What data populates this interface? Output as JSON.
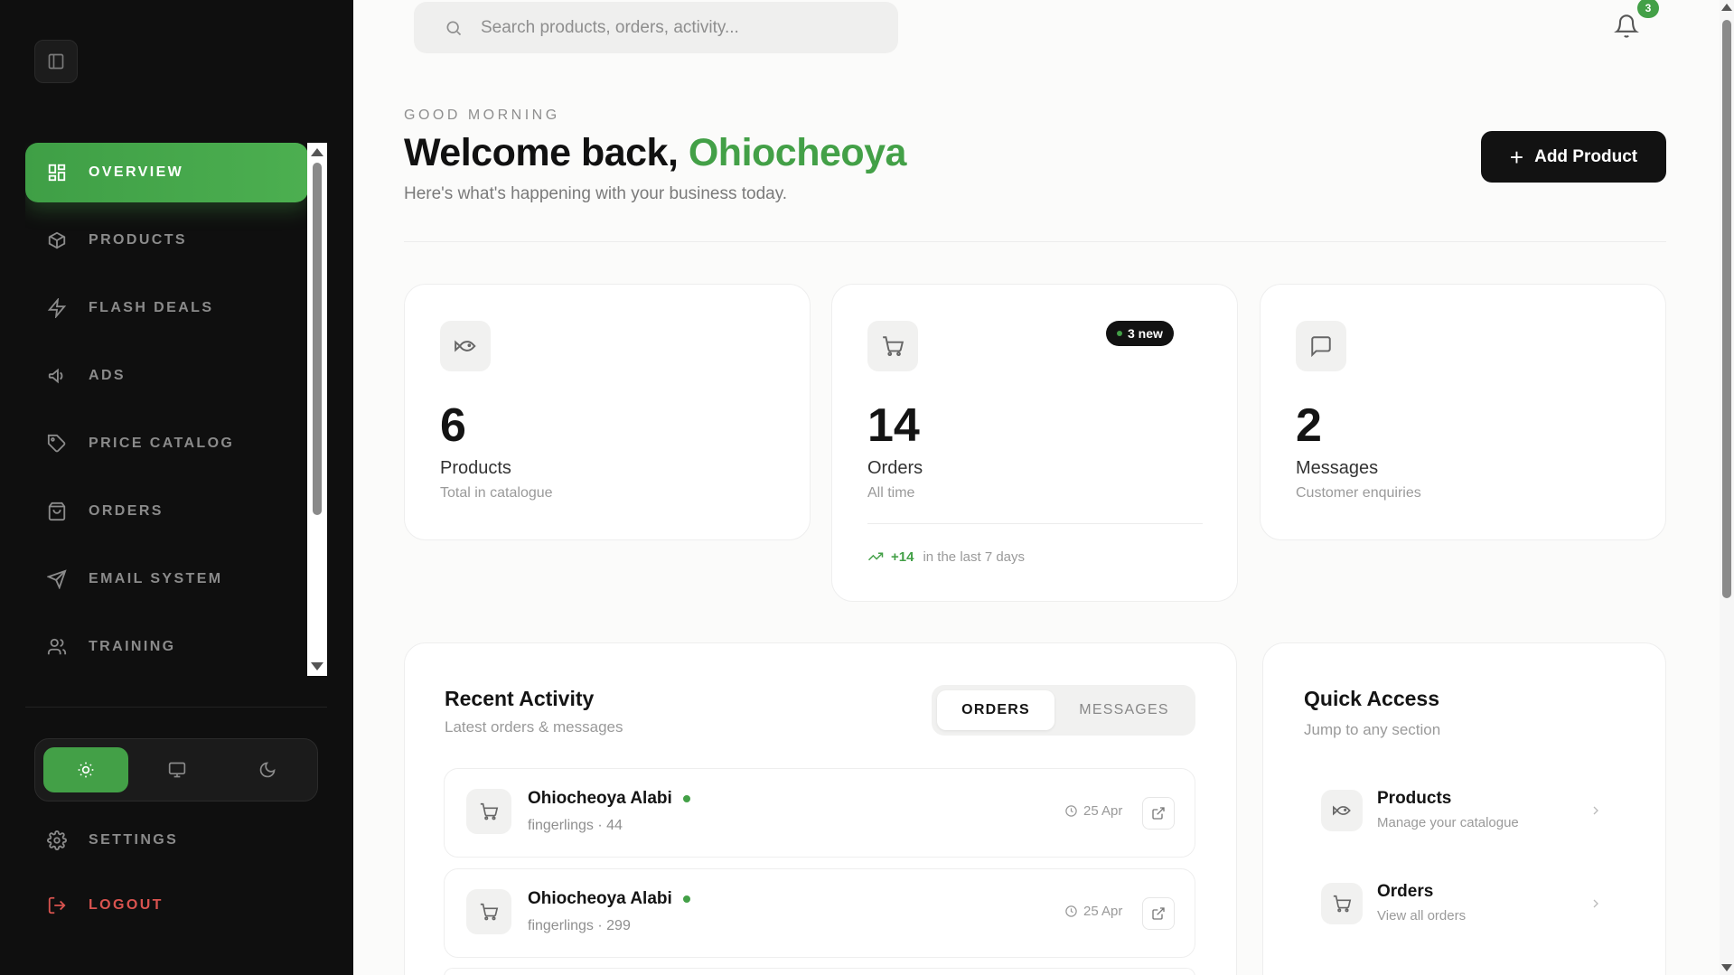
{
  "sidebar": {
    "nav_items": [
      {
        "label": "OVERVIEW",
        "icon": "grid-icon",
        "active": true
      },
      {
        "label": "PRODUCTS",
        "icon": "box-icon"
      },
      {
        "label": "FLASH DEALS",
        "icon": "lightning-icon"
      },
      {
        "label": "ADS",
        "icon": "megaphone-icon"
      },
      {
        "label": "PRICE CATALOG",
        "icon": "tag-icon"
      },
      {
        "label": "ORDERS",
        "icon": "shopping-bag-icon"
      },
      {
        "label": "EMAIL SYSTEM",
        "icon": "send-icon"
      },
      {
        "label": "TRAINING",
        "icon": "users-icon"
      }
    ],
    "theme_options": [
      "light",
      "system",
      "dark"
    ],
    "active_theme": "light",
    "settings_label": "SETTINGS",
    "logout_label": "LOGOUT"
  },
  "topbar": {
    "search_placeholder": "Search products, orders, activity...",
    "notification_count": "3"
  },
  "hero": {
    "greeting": "GOOD MORNING",
    "welcome_prefix": "Welcome back, ",
    "user_name": "Ohiocheoya",
    "subtitle": "Here's what's happening with your business today.",
    "add_button": "Add Product"
  },
  "stats": {
    "products": {
      "value": "6",
      "label": "Products",
      "sub": "Total in catalogue"
    },
    "orders": {
      "value": "14",
      "label": "Orders",
      "sub": "All time",
      "badge": "3 new",
      "trend_value": "+14",
      "trend_text": "in the last 7 days"
    },
    "messages": {
      "value": "2",
      "label": "Messages",
      "sub": "Customer enquiries"
    }
  },
  "recent_activity": {
    "title": "Recent Activity",
    "subtitle": "Latest orders & messages",
    "tabs": [
      "ORDERS",
      "MESSAGES"
    ],
    "rows": [
      {
        "name": "Ohiocheoya Alabi",
        "detail": "fingerlings · 44",
        "date": "25 Apr"
      },
      {
        "name": "Ohiocheoya Alabi",
        "detail": "fingerlings · 299",
        "date": "25 Apr"
      }
    ]
  },
  "quick_access": {
    "title": "Quick Access",
    "subtitle": "Jump to any section",
    "items": [
      {
        "title": "Products",
        "sub": "Manage your catalogue"
      },
      {
        "title": "Orders",
        "sub": "View all orders"
      }
    ]
  },
  "colors": {
    "accent": "#43a047",
    "sidebar_bg": "#0f0f0f",
    "danger": "#d9534f"
  }
}
